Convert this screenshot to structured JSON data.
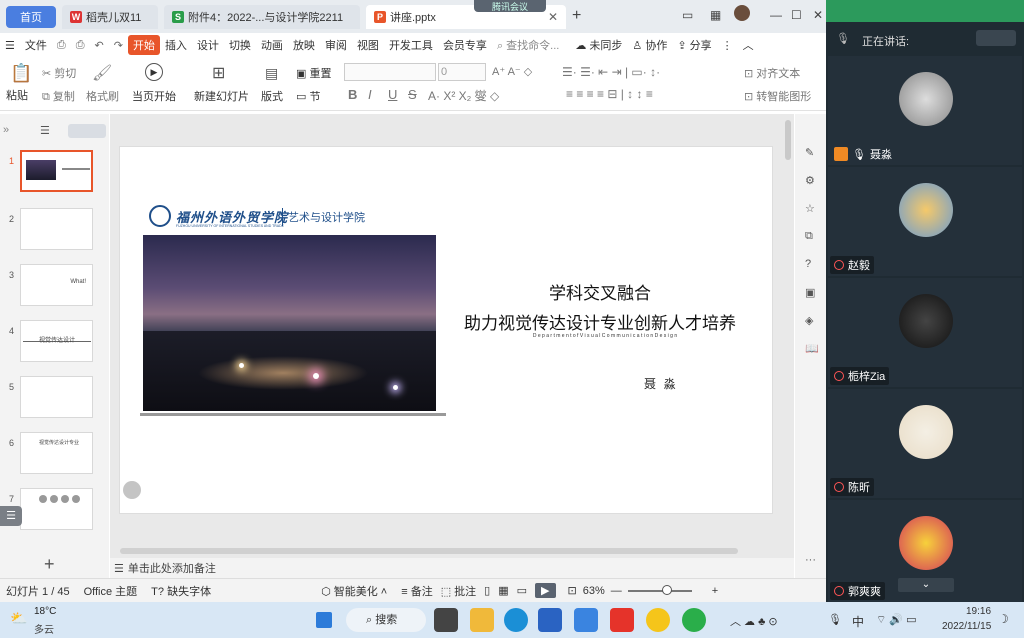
{
  "tabs": {
    "home": "首页",
    "doc1": "稻壳儿双11",
    "doc2": "附件4：2022-...与设计学院2211",
    "ppt": "讲座.pptx"
  },
  "meeting_badge": "腾讯会议",
  "menu": {
    "file": "文件",
    "items": [
      "开始",
      "插入",
      "设计",
      "切换",
      "动画",
      "放映",
      "审阅",
      "视图",
      "开发工具",
      "会员专享"
    ],
    "search_placeholder": "查找命令...",
    "unsynced": "未同步",
    "collab": "协作",
    "share": "分享"
  },
  "ribbon": {
    "paste": "粘贴",
    "cut": "剪切",
    "copy": "复制",
    "format_painter": "格式刷",
    "start_from_current": "当页开始",
    "new_slide": "新建幻灯片",
    "layout": "版式",
    "section": "节",
    "reset": "重置",
    "font_size": "0",
    "bold": "B",
    "italic": "I",
    "underline": "U",
    "strike": "S",
    "align_text": "对齐文本",
    "smart_graphic": "转智能图形"
  },
  "thumbnails": [
    "1",
    "2",
    "3",
    "4",
    "5",
    "6",
    "7"
  ],
  "thumb3_text": "What!",
  "thumb4_text": "视觉传达设计",
  "thumb6_text": "视觉传达设计专业",
  "slide": {
    "school_logo_text": "福州外语外贸学院",
    "school_sub": "FUZHOU UNIVERSITY OF INTERNATIONAL STUDIES AND TRADE",
    "college": "艺术与设计学院",
    "title_line1": "学科交叉融合",
    "title_line2": "助力视觉传达设计专业创新人才培养",
    "english": "D e p a r t m e n t   o f   V i s u a l   C o m m u n i c a t i o n   D e s i g n",
    "speaker": "聂  淼"
  },
  "notes_placeholder": "单击此处添加备注",
  "status": {
    "slide_info": "幻灯片 1 / 45",
    "theme": "Office 主题",
    "missing_font": "缺失字体",
    "beautify": "智能美化",
    "notes": "备注",
    "comments": "批注",
    "zoom": "63%"
  },
  "video_panel": {
    "speaking_label": "正在讲话:",
    "participants": [
      "聂淼",
      "赵毅",
      "栀梓Zia",
      "陈昕",
      "郭爽爽"
    ]
  },
  "taskbar": {
    "weather_temp": "18°C",
    "weather_desc": "多云",
    "search": "搜索",
    "ime": "中",
    "time": "19:16",
    "date": "2022/11/15"
  },
  "colors": {
    "accent": "#e8552a",
    "home_tab": "#4a7ee0",
    "video_bg": "#1f2b33"
  }
}
